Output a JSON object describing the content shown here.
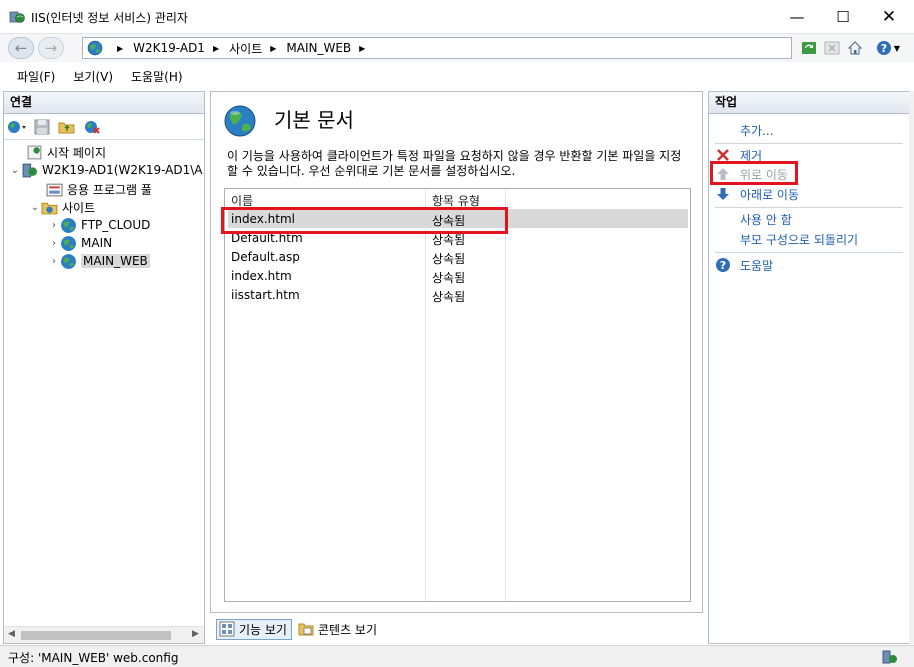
{
  "window": {
    "title": "IIS(인터넷 정보 서비스) 관리자",
    "minimize": "—",
    "maximize": "☐",
    "close": "✕"
  },
  "addressbar": {
    "breadcrumbs": [
      "W2K19-AD1",
      "사이트",
      "MAIN_WEB"
    ],
    "separator": "▶"
  },
  "menu": {
    "items": [
      "파일(F)",
      "보기(V)",
      "도움말(H)"
    ]
  },
  "connections": {
    "header": "연결",
    "tree": [
      {
        "label": "시작 페이지",
        "icon": "start-page-icon"
      },
      {
        "label": "W2K19-AD1(W2K19-AD1\\A",
        "icon": "server-icon",
        "expander": "⌄"
      },
      {
        "label": "응용 프로그램 풀",
        "icon": "app-pool-icon"
      },
      {
        "label": "사이트",
        "icon": "sites-folder-icon",
        "expander": "⌄"
      },
      {
        "label": "FTP_CLOUD",
        "icon": "globe-icon",
        "expander": "›"
      },
      {
        "label": "MAIN",
        "icon": "globe-icon",
        "expander": "›"
      },
      {
        "label": "MAIN_WEB",
        "icon": "globe-icon",
        "expander": "›",
        "selected": true
      }
    ],
    "scroll_left": "◀",
    "scroll_right": "▶"
  },
  "feature": {
    "title": "기본 문서",
    "description": "이 기능을 사용하여 클라이언트가 특정 파일을 요청하지 않을 경우 반환할 기본 파일을 지정할 수 있습니다. 우선 순위대로 기본 문서를 설정하십시오.",
    "columns": [
      "이름",
      "항목 유형"
    ],
    "rows": [
      {
        "name": "index.html",
        "type": "상속됨",
        "selected": true
      },
      {
        "name": "Default.htm",
        "type": "상속됨"
      },
      {
        "name": "Default.asp",
        "type": "상속됨"
      },
      {
        "name": "index.htm",
        "type": "상속됨"
      },
      {
        "name": "iisstart.htm",
        "type": "상속됨"
      }
    ],
    "highlight_color": "#e3141e"
  },
  "view_tabs": {
    "features": "기능 보기",
    "content": "콘텐츠 보기"
  },
  "actions": {
    "header": "작업",
    "add": "추가...",
    "remove": "제거",
    "move_up": "위로 이동",
    "move_down": "아래로 이동",
    "disable": "사용 안 함",
    "revert": "부모 구성으로 되돌리기",
    "help": "도움말"
  },
  "status": {
    "text": "구성: 'MAIN_WEB' web.config"
  }
}
